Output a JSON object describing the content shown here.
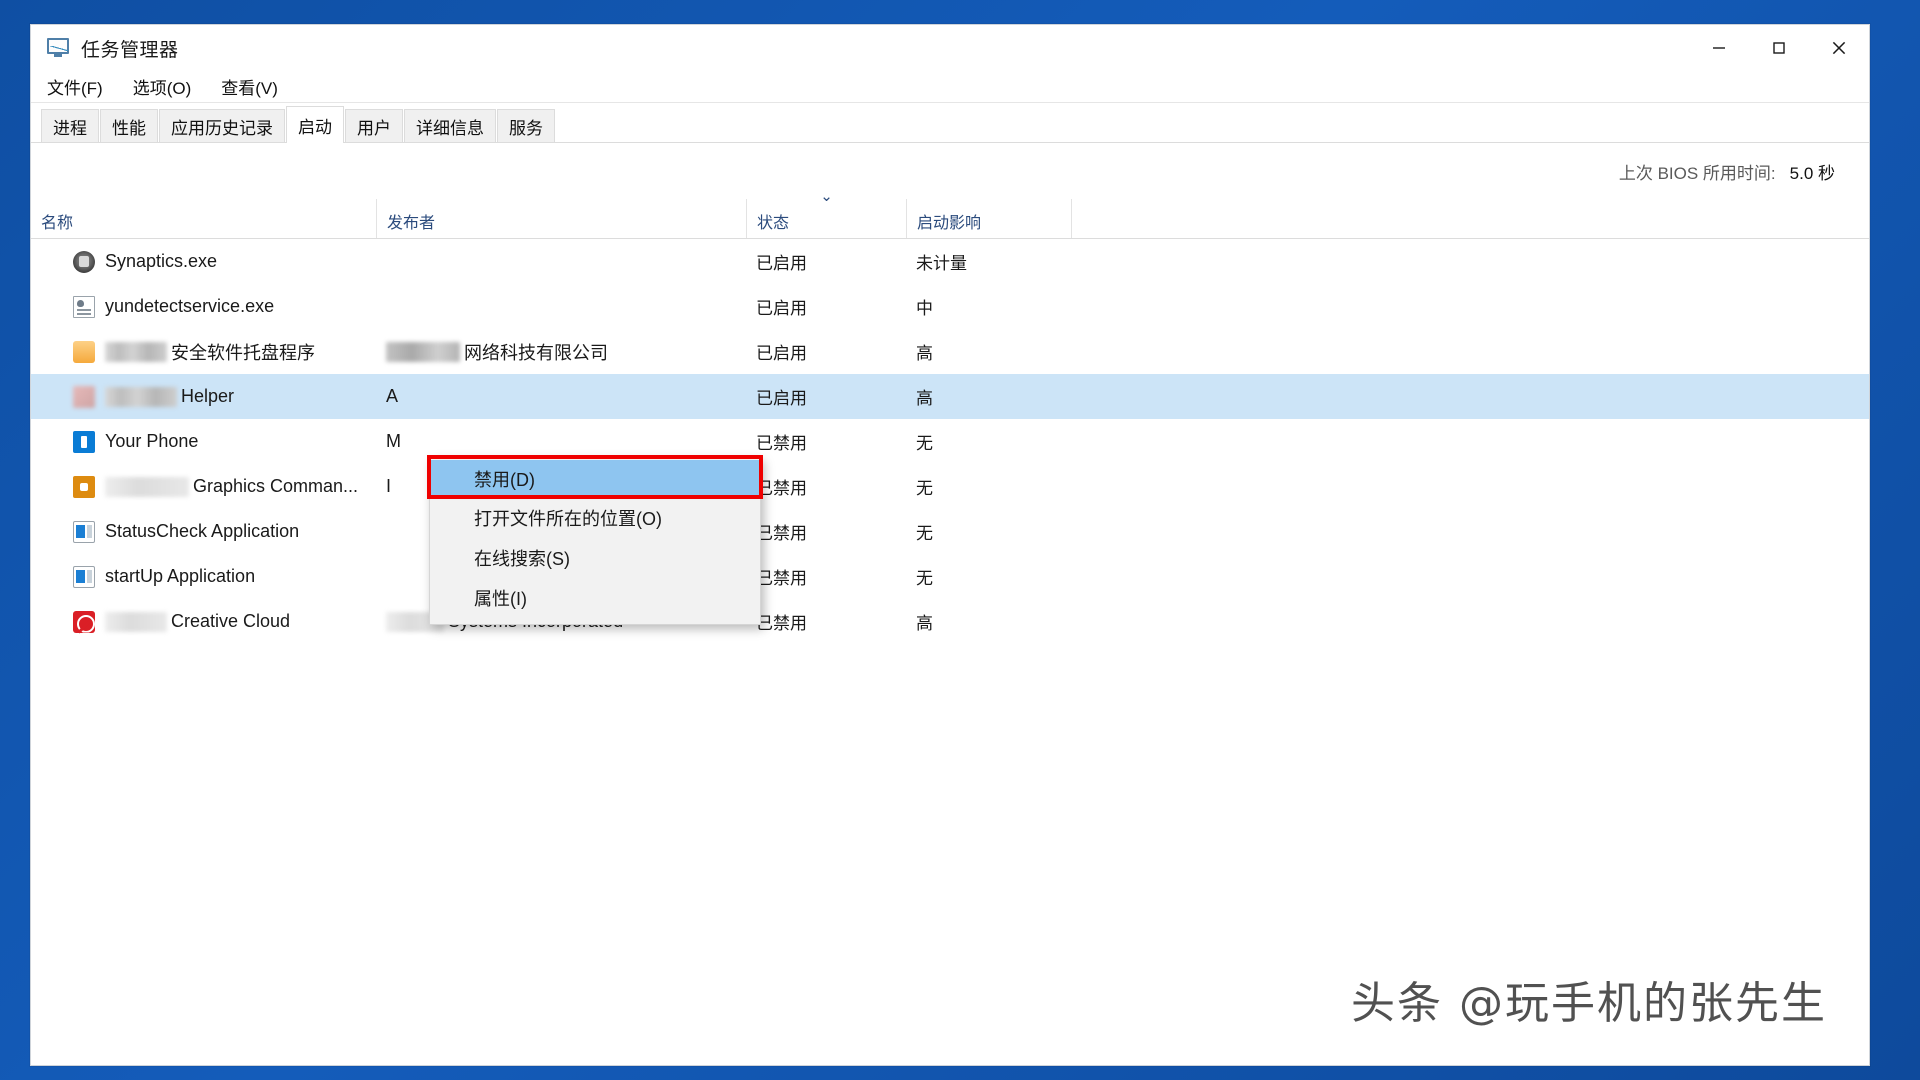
{
  "window": {
    "title": "任务管理器",
    "icon": "task-manager-icon",
    "controls": {
      "minimize": "–",
      "maximize": "□",
      "close": "✕"
    }
  },
  "menubar": {
    "items": [
      {
        "label": "文件(F)",
        "name": "menu-file"
      },
      {
        "label": "选项(O)",
        "name": "menu-options"
      },
      {
        "label": "查看(V)",
        "name": "menu-view"
      }
    ]
  },
  "tabs": {
    "active": "启动",
    "items": [
      {
        "label": "进程"
      },
      {
        "label": "性能"
      },
      {
        "label": "应用历史记录"
      },
      {
        "label": "启动"
      },
      {
        "label": "用户"
      },
      {
        "label": "详细信息"
      },
      {
        "label": "服务"
      }
    ]
  },
  "bios": {
    "label": "上次 BIOS 所用时间:",
    "value": "5.0 秒"
  },
  "columns": {
    "name": "名称",
    "publisher": "发布者",
    "status": "状态",
    "impact": "启动影响",
    "sort_marker": "⌄"
  },
  "rows": [
    {
      "name": "Synaptics.exe",
      "name_redacted": false,
      "publisher": "",
      "publisher_redacted": false,
      "status": "已启用",
      "impact": "未计量",
      "icon": "synaptics-icon",
      "selected": false
    },
    {
      "name": "yundetectservice.exe",
      "name_redacted": false,
      "publisher": "",
      "publisher_redacted": false,
      "status": "已启用",
      "impact": "中",
      "icon": "document-icon",
      "selected": false
    },
    {
      "name": "安全软件托盘程序",
      "name_redacted": true,
      "publisher": "网络科技有限公司",
      "publisher_redacted": true,
      "status": "已启用",
      "impact": "高",
      "icon": "shield-icon",
      "selected": false
    },
    {
      "name": "Helper",
      "name_redacted": true,
      "publisher": "A",
      "publisher_redacted": false,
      "status": "已启用",
      "impact": "高",
      "icon": "helper-icon",
      "selected": true
    },
    {
      "name": "Your Phone",
      "name_redacted": false,
      "publisher": "M",
      "publisher_redacted": false,
      "status": "已禁用",
      "impact": "无",
      "icon": "your-phone-icon",
      "selected": false
    },
    {
      "name": "Graphics Comman...",
      "name_redacted": true,
      "publisher": "I",
      "publisher_redacted": false,
      "status": "已禁用",
      "impact": "无",
      "icon": "graphics-command-icon",
      "selected": false
    },
    {
      "name": "StatusCheck Application",
      "name_redacted": false,
      "publisher": "",
      "publisher_redacted": false,
      "status": "已禁用",
      "impact": "无",
      "icon": "status-check-icon",
      "selected": false
    },
    {
      "name": "startUp Application",
      "name_redacted": false,
      "publisher": "",
      "publisher_redacted": false,
      "status": "已禁用",
      "impact": "无",
      "icon": "startup-app-icon",
      "selected": false
    },
    {
      "name": "Creative Cloud",
      "name_redacted": true,
      "publisher": "Systems Incorporated",
      "publisher_redacted": true,
      "status": "已禁用",
      "impact": "高",
      "icon": "adobe-creative-cloud-icon",
      "selected": false
    }
  ],
  "context_menu": {
    "items": [
      {
        "label": "禁用(D)",
        "highlighted": true
      },
      {
        "label": "打开文件所在的位置(O)",
        "highlighted": false
      },
      {
        "label": "在线搜索(S)",
        "highlighted": false
      },
      {
        "label": "属性(I)",
        "highlighted": false
      }
    ]
  },
  "watermark": {
    "text": "头条 @玩手机的张先生"
  },
  "colors": {
    "desktop_blue": "#145cba",
    "selection_blue": "#cce4f7",
    "menu_highlight": "#8ec5f0",
    "annotation_red": "#ef0000",
    "header_text": "#2b4b7d"
  }
}
